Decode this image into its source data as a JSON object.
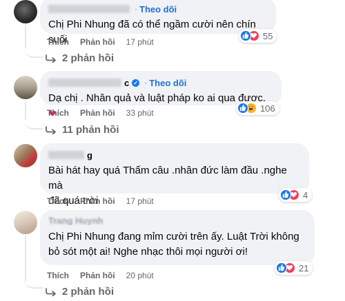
{
  "comments": [
    {
      "follow_label": "Theo dõi",
      "text": "Chị Phi Nhung đã có thể ngầm cười nên chín suối",
      "reaction_count": "55",
      "like_label": "Thích",
      "reply_label": "Phản hồi",
      "time": "17 phút",
      "replies_label": "2 phản hồi"
    },
    {
      "name_suffix": "c",
      "follow_label": "Theo dõi",
      "text": "Dạ chị . Nhân quả và luật pháp ko ai qua được.",
      "reaction_count": "106",
      "like_label": "Thích",
      "reply_label": "Phản hồi",
      "time": "33 phút",
      "replies_label": "11 phản hồi"
    },
    {
      "name_suffix": "g",
      "text_line1": "Bài hát hay quá Thấm câu .nhân đức làm đầu .nghe mà",
      "text_line2": "đã quá trời",
      "reaction_count": "4",
      "like_label": "Thích",
      "reply_label": "Phản hồi",
      "time": "17 phút"
    },
    {
      "name": "Trang Huynh",
      "text_line1": "Chị Phi Nhung đang mỉm cười trên ấy. Luật Trời không",
      "text_line2": "bỏ sót một ai! Nghe nhạc thôi mọi người ơi!",
      "reaction_count": "21",
      "like_label": "Thích",
      "reply_label": "Phản hồi",
      "time": "20 phút",
      "replies_label": "2 phản hồi"
    }
  ],
  "icons": {
    "like": "like-reaction-icon",
    "love": "love-reaction-icon",
    "haha": "haha-reaction-icon",
    "verified": "verified-badge-icon",
    "reply_arrow": "reply-arrow-icon",
    "heart_emoji": "red-heart-emoji"
  },
  "colors": {
    "bubble": "#f0f2f5",
    "follow": "#216fdb",
    "muted": "#65676b",
    "like": "#1877f2",
    "love": "#f33e58",
    "haha": "#f7b125"
  }
}
